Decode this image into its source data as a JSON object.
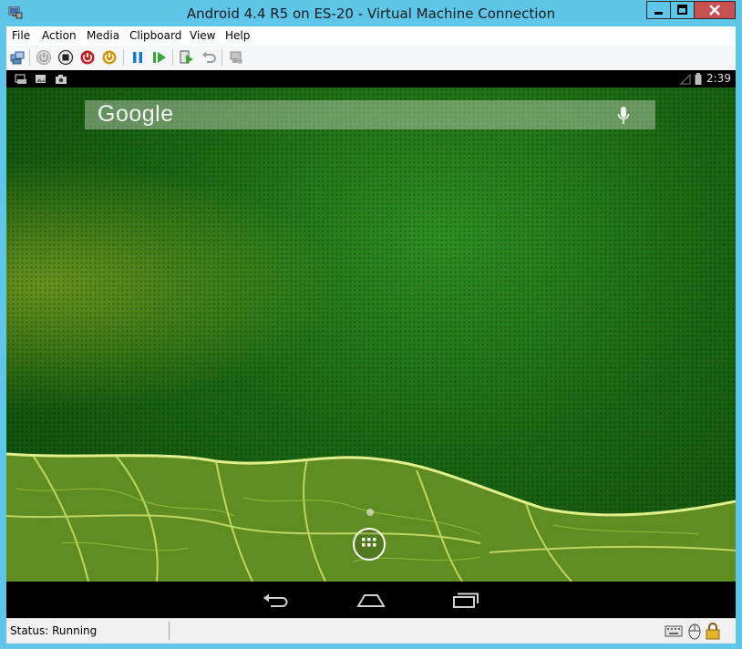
{
  "window": {
    "title": "Android 4.4 R5 on ES-20 - Virtual Machine Connection",
    "controls": {
      "minimize": "minimize-icon",
      "maximize": "maximize-icon",
      "close": "close-icon"
    },
    "colors": {
      "frame": "#5fc6e9",
      "close": "#c75050"
    }
  },
  "menu": [
    "File",
    "Action",
    "Media",
    "Clipboard",
    "View",
    "Help"
  ],
  "toolbar": {
    "icons": [
      "ctrl-alt-del-icon",
      "start-icon",
      "turn-off-icon",
      "shut-down-icon",
      "save-icon",
      "pause-icon",
      "resume-icon",
      "snapshot-icon",
      "revert-icon",
      "enhanced-session-icon"
    ]
  },
  "android": {
    "status_bar": {
      "time": "2:39",
      "notification_icons": [
        "screenshot-notification-icon",
        "image-notification-icon",
        "camera-notification-icon"
      ]
    },
    "search": {
      "brand": "Google",
      "mic_icon": "mic-icon"
    },
    "nav": {
      "back": "back-icon",
      "home": "home-icon",
      "recents": "recents-icon"
    },
    "colors": {
      "wallpaper": "#1b6613",
      "accent": "#cfe36a"
    }
  },
  "status": {
    "text": "Status: Running",
    "icons": [
      "keyboard-icon",
      "mouse-icon",
      "lock-icon"
    ]
  }
}
